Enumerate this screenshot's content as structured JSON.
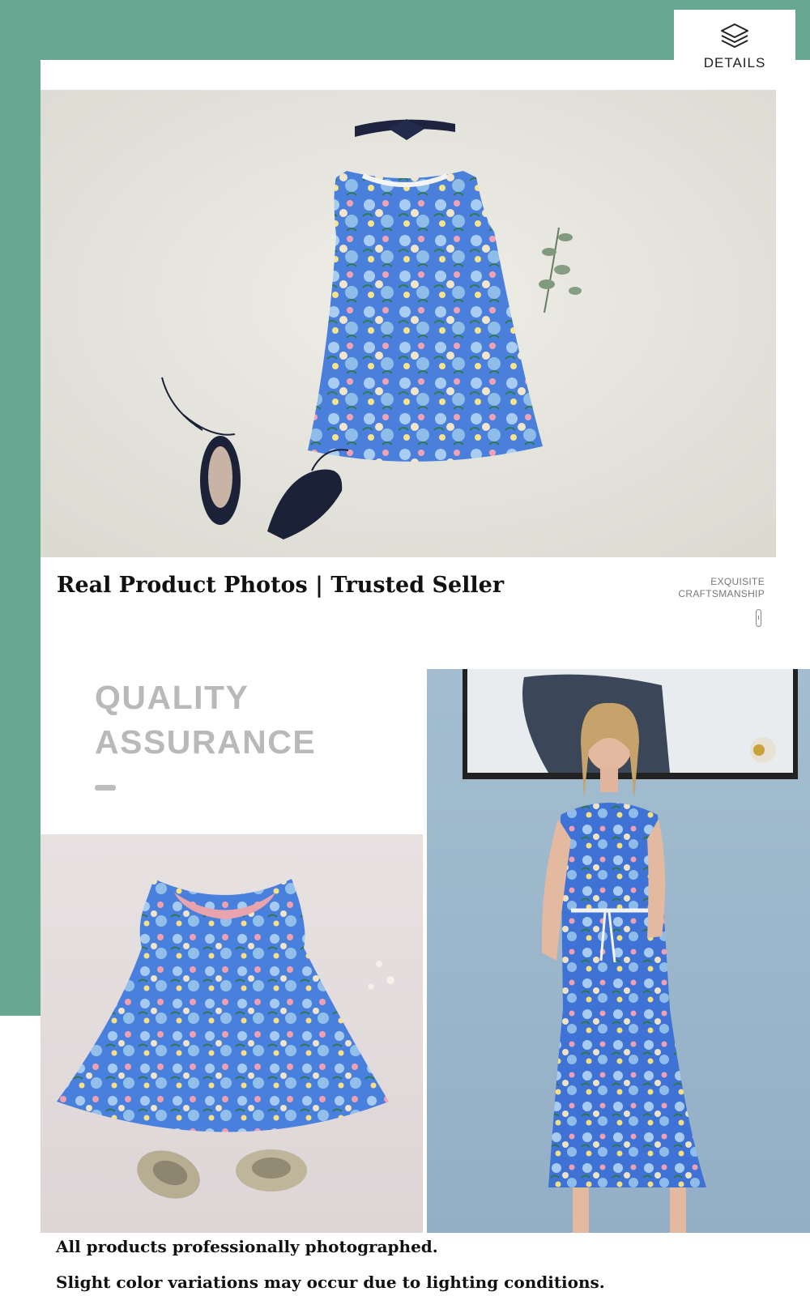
{
  "details_tab": {
    "label": "DETAILS",
    "icon": "layers-icon"
  },
  "hero": {
    "photo": "flat-lay-floral-dress-headband-shoes-eucalyptus",
    "tagline": "Real Product Photos | Trusted Seller"
  },
  "craftsmanship": {
    "line1": "EXQUISITE",
    "line2": "CRAFTSMANSHIP"
  },
  "quality": {
    "line1": "QUALITY",
    "line2": "ASSURANCE"
  },
  "gallery": {
    "child_photo": "child-floral-dress-with-gold-shoes-and-pearls",
    "model_photo": "model-wearing-floral-midi-dress"
  },
  "footer": {
    "line1": "All products professionally photographed.",
    "line2": "Slight color variations may occur due to lighting conditions."
  },
  "colors": {
    "accent_green": "#68a791",
    "floral_blue": "#3f74d6"
  }
}
